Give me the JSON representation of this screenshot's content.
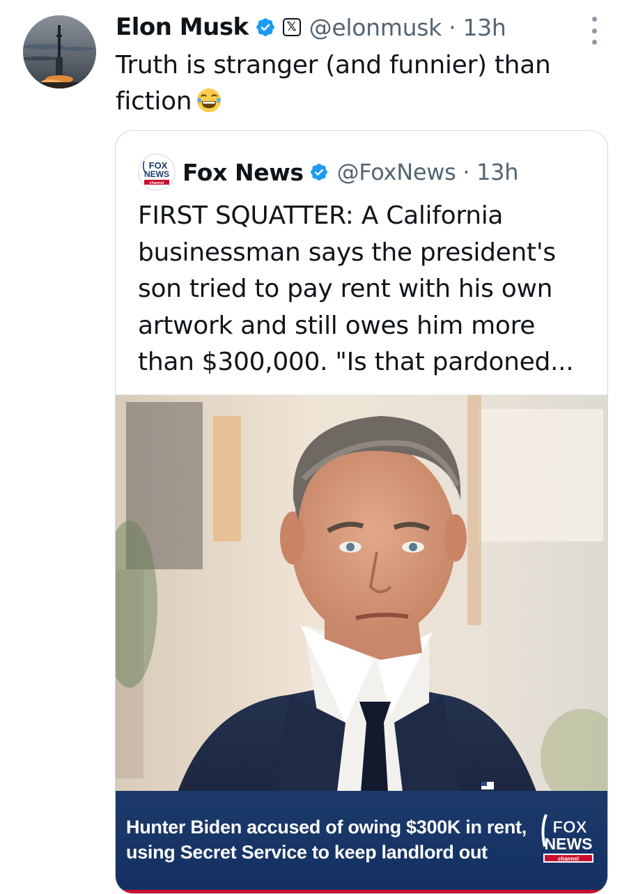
{
  "tweet": {
    "author_name": "Elon Musk",
    "author_handle": "@elonmusk · 13h",
    "text": "Truth is stranger (and funnier) than fiction",
    "emoji": "😂",
    "x_badge": "𝕏"
  },
  "quoted": {
    "author_name": "Fox News",
    "author_handle": "@FoxNews · 13h",
    "text": "FIRST SQUATTER: A California businessman says the president's son tried to pay rent with his own artwork and still owes him more than $300,000. \"Is that pardoned...",
    "media": {
      "caption": "Hunter Biden accused of owing $300K in rent, using Secret Service to keep landlord out"
    }
  },
  "colors": {
    "verified": "#1d9bf0",
    "secondary_text": "#536471",
    "lower_third": "#143063",
    "fox_red": "#c8102e"
  },
  "icons": [
    "verified-icon",
    "x-badge-icon",
    "more-icon",
    "joy-emoji-icon",
    "fox-news-logo-icon"
  ]
}
